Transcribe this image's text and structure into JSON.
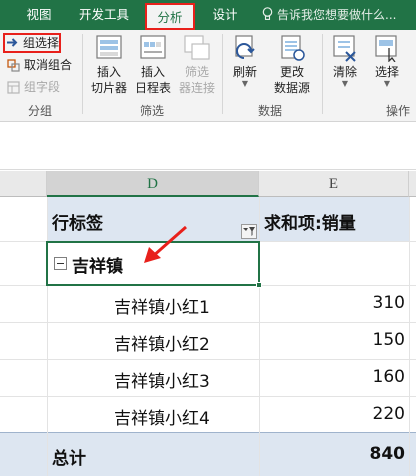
{
  "tabs": {
    "view": "视图",
    "developer": "开发工具",
    "analyze": "分析",
    "design": "设计",
    "tell_me": "告诉我您想要做什么..."
  },
  "ribbon": {
    "group": {
      "group_selection": "组选择",
      "ungroup": "取消组合",
      "group_field": "组字段",
      "label": "分组"
    },
    "filter": {
      "insert_slicer_1": "插入",
      "insert_slicer_2": "切片器",
      "insert_timeline_1": "插入",
      "insert_timeline_2": "日程表",
      "filter_connections_1": "筛选",
      "filter_connections_2": "器连接",
      "label": "筛选"
    },
    "data": {
      "refresh": "刷新",
      "change_source_1": "更改",
      "change_source_2": "数据源",
      "label": "数据"
    },
    "actions": {
      "clear": "清除",
      "select": "选择",
      "label": "操作"
    }
  },
  "sheet": {
    "columns": [
      "D",
      "E"
    ],
    "header": {
      "row_labels": "行标签",
      "sum_label": "求和项:销量"
    },
    "group": {
      "name": "吉祥镇"
    },
    "rows": [
      {
        "label": "吉祥镇小红1",
        "value": "310"
      },
      {
        "label": "吉祥镇小红2",
        "value": "150"
      },
      {
        "label": "吉祥镇小红3",
        "value": "160"
      },
      {
        "label": "吉祥镇小红4",
        "value": "220"
      }
    ],
    "total": {
      "label": "总计",
      "value": "840"
    }
  },
  "colors": {
    "ribbon_green": "#217346",
    "highlight_red": "#e8201b",
    "pivot_band": "#dde6f1"
  }
}
